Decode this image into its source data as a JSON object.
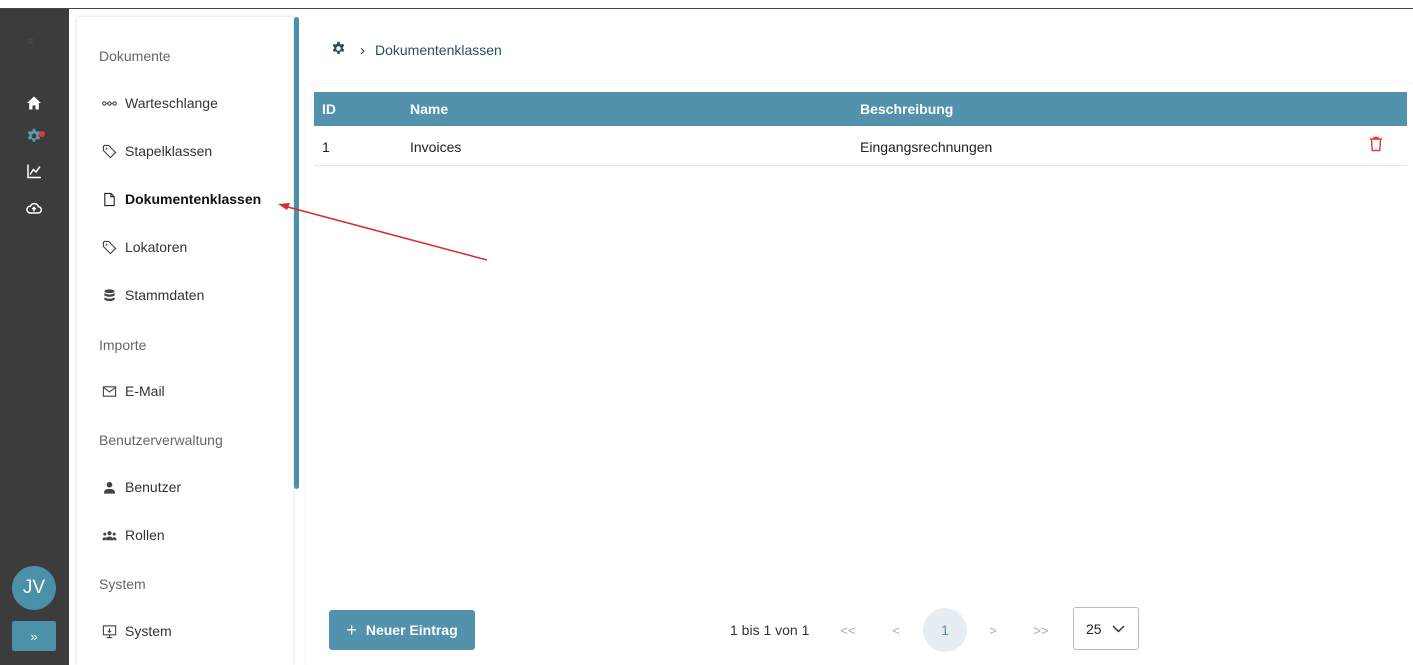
{
  "rail": {
    "icons": [
      "home-icon",
      "settings-icon",
      "chart-icon",
      "cloud-upload-icon"
    ],
    "avatar_initials": "JV",
    "expand_label": "»"
  },
  "nav": {
    "groups": {
      "dokumente": "Dokumente",
      "importe": "Importe",
      "benutzerverwaltung": "Benutzerverwaltung",
      "system": "System"
    },
    "items": {
      "warteschlange": "Warteschlange",
      "stapelklassen": "Stapelklassen",
      "dokumentenklassen": "Dokumentenklassen",
      "lokatoren": "Lokatoren",
      "stammdaten": "Stammdaten",
      "email": "E-Mail",
      "benutzer": "Benutzer",
      "rollen": "Rollen",
      "system": "System"
    },
    "active_item": "dokumentenklassen"
  },
  "breadcrumb": {
    "current": "Dokumentenklassen"
  },
  "table": {
    "columns": [
      "ID",
      "Name",
      "Beschreibung"
    ],
    "rows": [
      {
        "id": "1",
        "name": "Invoices",
        "beschreibung": "Eingangsrechnungen"
      }
    ]
  },
  "footer": {
    "add_label": "Neuer Eintrag",
    "pager_info": "1 bis 1 von 1",
    "first": "<<",
    "prev": "<",
    "current_page": "1",
    "next": ">",
    "last": ">>",
    "page_size": "25"
  },
  "colors": {
    "accent": "#5292ac",
    "rail": "#3c3c3c",
    "delete": "#e53935",
    "annotation": "#d32f2f"
  }
}
